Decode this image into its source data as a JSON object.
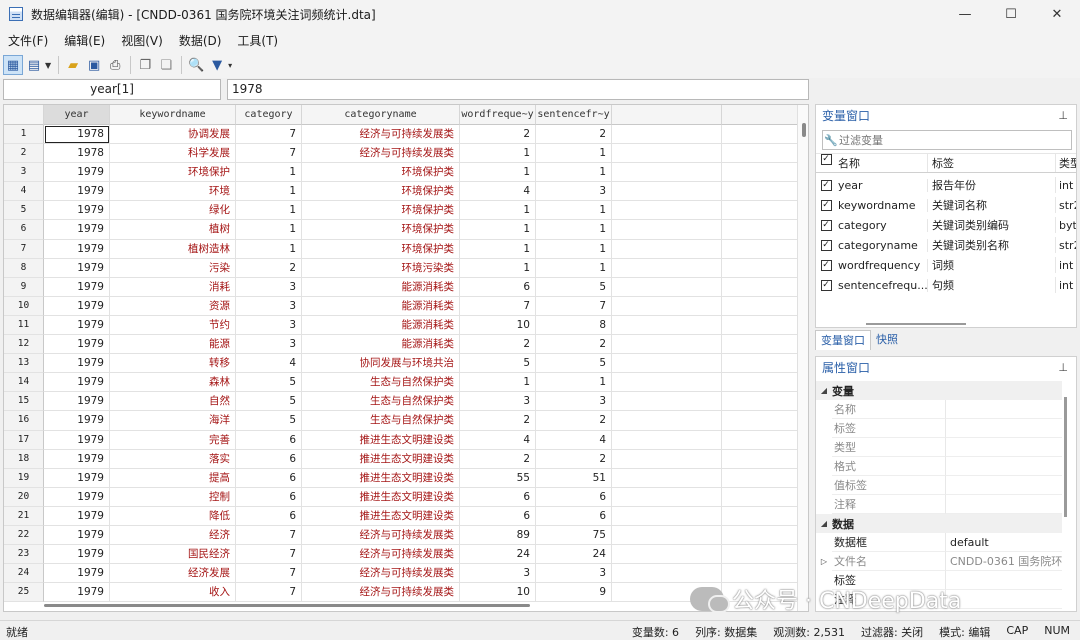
{
  "window": {
    "title": "数据编辑器(编辑) - [CNDD-0361 国务院环境关注词频统计.dta]",
    "min_glyph": "—",
    "max_glyph": "☐",
    "close_glyph": "✕"
  },
  "menu": [
    "文件(F)",
    "编辑(E)",
    "视图(V)",
    "数据(D)",
    "工具(T)"
  ],
  "toolbar": {
    "icons": [
      "grid-edit-icon",
      "grid-browse-icon",
      "open-folder-icon",
      "save-icon",
      "print-icon",
      "copy-icon",
      "paste-icon",
      "search-icon",
      "filter-icon"
    ]
  },
  "varbar": {
    "name": "year[1]",
    "value": "1978"
  },
  "grid": {
    "columns": [
      "year",
      "keywordname",
      "category",
      "categoryname",
      "wordfreque~y",
      "sentencefr~y"
    ],
    "rows": [
      [
        "1",
        "1978",
        "协调发展",
        "7",
        "经济与可持续发展类",
        "2",
        "2"
      ],
      [
        "2",
        "1978",
        "科学发展",
        "7",
        "经济与可持续发展类",
        "1",
        "1"
      ],
      [
        "3",
        "1979",
        "环境保护",
        "1",
        "环境保护类",
        "1",
        "1"
      ],
      [
        "4",
        "1979",
        "环境",
        "1",
        "环境保护类",
        "4",
        "3"
      ],
      [
        "5",
        "1979",
        "绿化",
        "1",
        "环境保护类",
        "1",
        "1"
      ],
      [
        "6",
        "1979",
        "植树",
        "1",
        "环境保护类",
        "1",
        "1"
      ],
      [
        "7",
        "1979",
        "植树造林",
        "1",
        "环境保护类",
        "1",
        "1"
      ],
      [
        "8",
        "1979",
        "污染",
        "2",
        "环境污染类",
        "1",
        "1"
      ],
      [
        "9",
        "1979",
        "消耗",
        "3",
        "能源消耗类",
        "6",
        "5"
      ],
      [
        "10",
        "1979",
        "资源",
        "3",
        "能源消耗类",
        "7",
        "7"
      ],
      [
        "11",
        "1979",
        "节约",
        "3",
        "能源消耗类",
        "10",
        "8"
      ],
      [
        "12",
        "1979",
        "能源",
        "3",
        "能源消耗类",
        "2",
        "2"
      ],
      [
        "13",
        "1979",
        "转移",
        "4",
        "协同发展与环境共治",
        "5",
        "5"
      ],
      [
        "14",
        "1979",
        "森林",
        "5",
        "生态与自然保护类",
        "1",
        "1"
      ],
      [
        "15",
        "1979",
        "自然",
        "5",
        "生态与自然保护类",
        "3",
        "3"
      ],
      [
        "16",
        "1979",
        "海洋",
        "5",
        "生态与自然保护类",
        "2",
        "2"
      ],
      [
        "17",
        "1979",
        "完善",
        "6",
        "推进生态文明建设类",
        "4",
        "4"
      ],
      [
        "18",
        "1979",
        "落实",
        "6",
        "推进生态文明建设类",
        "2",
        "2"
      ],
      [
        "19",
        "1979",
        "提高",
        "6",
        "推进生态文明建设类",
        "55",
        "51"
      ],
      [
        "20",
        "1979",
        "控制",
        "6",
        "推进生态文明建设类",
        "6",
        "6"
      ],
      [
        "21",
        "1979",
        "降低",
        "6",
        "推进生态文明建设类",
        "6",
        "6"
      ],
      [
        "22",
        "1979",
        "经济",
        "7",
        "经济与可持续发展类",
        "89",
        "75"
      ],
      [
        "23",
        "1979",
        "国民经济",
        "7",
        "经济与可持续发展类",
        "24",
        "24"
      ],
      [
        "24",
        "1979",
        "经济发展",
        "7",
        "经济与可持续发展类",
        "3",
        "3"
      ],
      [
        "25",
        "1979",
        "收入",
        "7",
        "经济与可持续发展类",
        "10",
        "9"
      ]
    ]
  },
  "variables_panel": {
    "title": "变量窗口",
    "pin": "📌",
    "filter_placeholder": "过滤变量",
    "headers": {
      "name": "名称",
      "label": "标签",
      "type": "类型"
    },
    "vars": [
      {
        "name": "year",
        "label": "报告年份",
        "type": "int"
      },
      {
        "name": "keywordname",
        "label": "关键词名称",
        "type": "str27"
      },
      {
        "name": "category",
        "label": "关键词类别编码",
        "type": "byte"
      },
      {
        "name": "categoryname",
        "label": "关键词类别名称",
        "type": "str27"
      },
      {
        "name": "wordfrequency",
        "label": "词频",
        "type": "int"
      },
      {
        "name": "sentencefrequ...",
        "label": "句频",
        "type": "int"
      }
    ]
  },
  "tabs": [
    "变量窗口",
    "快照"
  ],
  "properties_panel": {
    "title": "属性窗口",
    "pin": "📌",
    "group_var": "变量",
    "var_keys": [
      "名称",
      "标签",
      "类型",
      "格式",
      "值标签",
      "注释"
    ],
    "group_data": "数据",
    "data_rows": [
      {
        "key": "数据框",
        "value": "default"
      },
      {
        "key": "文件名",
        "value": "CNDD-0361 国务院环"
      },
      {
        "key": "标签",
        "value": ""
      },
      {
        "key": "注释",
        "value": ""
      }
    ]
  },
  "watermark": "公众号 · CNDeepData",
  "status": {
    "left": "就绪",
    "vars": "变量数: 6",
    "order": "列序: 数据集",
    "obs": "观测数: 2,531",
    "filter": "过滤器: 关闭",
    "mode": "模式: 编辑",
    "cap": "CAP",
    "num": "NUM"
  }
}
